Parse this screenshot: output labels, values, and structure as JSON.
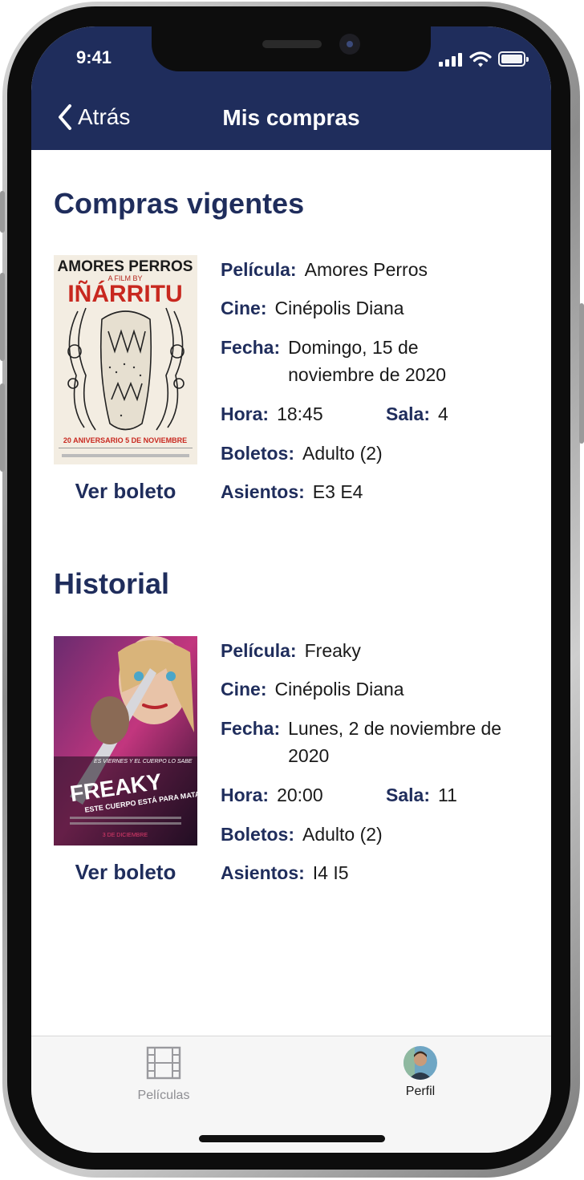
{
  "status_bar": {
    "time": "9:41"
  },
  "nav": {
    "back_label": "Atrás",
    "title": "Mis compras"
  },
  "sections": [
    {
      "title": "Compras vigentes",
      "purchase": {
        "poster_text": [
          "AMORES PERROS",
          "A FILM BY",
          "IÑÁRRITU",
          "20 ANIVERSARIO 5 DE NOVIEMBRE"
        ],
        "ver_boleto": "Ver boleto",
        "labels": {
          "pelicula": "Película:",
          "cine": "Cine:",
          "fecha": "Fecha:",
          "hora": "Hora:",
          "sala": "Sala:",
          "boletos": "Boletos:",
          "asientos": "Asientos:"
        },
        "pelicula": "Amores Perros",
        "cine": "Cinépolis Diana",
        "fecha": "Domingo, 15 de noviembre de 2020",
        "hora": "18:45",
        "sala": "4",
        "boletos": "Adulto (2)",
        "asientos": "E3 E4"
      }
    },
    {
      "title": "Historial",
      "purchase": {
        "poster_text": [
          "ES VIERNES Y EL CUERPO LO SABE",
          "FREAKY",
          "ESTE CUERPO ESTÁ PARA MATAR",
          "3 DE DICIEMBRE"
        ],
        "ver_boleto": "Ver boleto",
        "labels": {
          "pelicula": "Película:",
          "cine": "Cine:",
          "fecha": "Fecha:",
          "hora": "Hora:",
          "sala": "Sala:",
          "boletos": "Boletos:",
          "asientos": "Asientos:"
        },
        "pelicula": "Freaky",
        "cine": "Cinépolis Diana",
        "fecha": "Lunes, 2 de noviembre de 2020",
        "hora": "20:00",
        "sala": "11",
        "boletos": "Adulto (2)",
        "asientos": "I4 I5"
      }
    }
  ],
  "tabbar": {
    "items": [
      {
        "label": "Películas",
        "icon": "film-icon",
        "selected": false,
        "color": "#8e8e93"
      },
      {
        "label": "Perfil",
        "icon": "avatar",
        "selected": true,
        "color": "#1a1a1a"
      }
    ]
  },
  "colors": {
    "primary": "#1f2d5c",
    "background": "#ffffff",
    "tabbar": "#f6f6f6"
  }
}
